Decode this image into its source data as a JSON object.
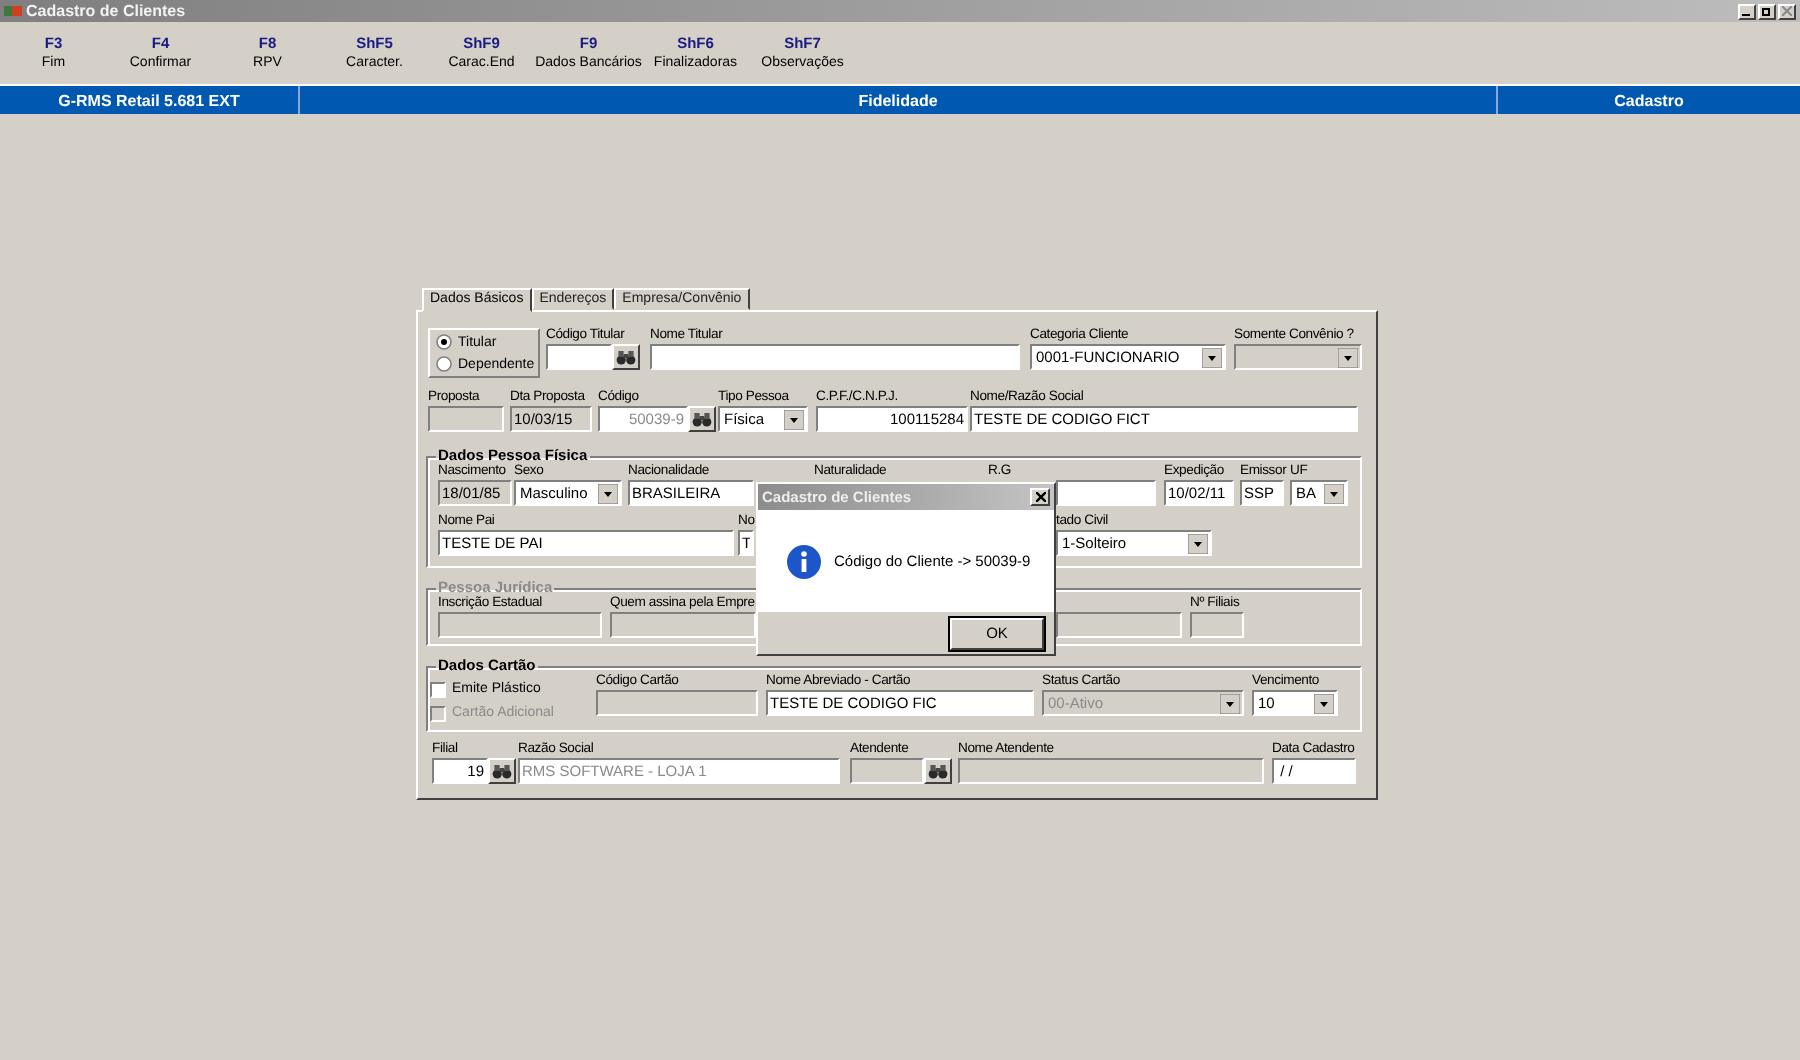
{
  "window": {
    "title": "Cadastro de Clientes"
  },
  "function_keys": [
    {
      "key": "F3",
      "label": "Fim"
    },
    {
      "key": "F4",
      "label": "Confirmar"
    },
    {
      "key": "F8",
      "label": "RPV"
    },
    {
      "key": "ShF5",
      "label": "Caracter."
    },
    {
      "key": "ShF9",
      "label": "Carac.End"
    },
    {
      "key": "F9",
      "label": "Dados Bancários"
    },
    {
      "key": "ShF6",
      "label": "Finalizadoras"
    },
    {
      "key": "ShF7",
      "label": "Observações"
    }
  ],
  "status_bar": [
    "G-RMS Retail 5.681 EXT",
    "Fidelidade",
    "Cadastro"
  ],
  "tabs": [
    {
      "label": "Dados Básicos",
      "selected": true
    },
    {
      "label": "Endereços",
      "selected": false
    },
    {
      "label": "Empresa/Convênio",
      "selected": false
    }
  ],
  "holder_type": [
    {
      "label": "Titular",
      "selected": true
    },
    {
      "label": "Dependente",
      "selected": false
    }
  ],
  "header_rows": [
    [
      {
        "label": "Código Titular",
        "kind": "text",
        "read_only": false,
        "lookup": true
      },
      {
        "label": "Nome Titular",
        "kind": "text",
        "read_only": false
      },
      {
        "label": "Categoria Cliente",
        "kind": "select",
        "read_only": false,
        "disabled": false,
        "value": "0001-FUNCIONARIO"
      },
      {
        "label": "Somente Convênio ?",
        "kind": "select",
        "read_only": true
      }
    ],
    [
      {
        "label": "Proposta",
        "kind": "text",
        "read_only": true
      },
      {
        "label": "Dta Proposta",
        "kind": "text",
        "read_only": true,
        "disabled": false,
        "value": "10/03/15"
      },
      {
        "label": "Código",
        "kind": "number",
        "read_only": false,
        "disabled": true,
        "value": "50039-9",
        "lookup": true
      },
      {
        "label": "Tipo Pessoa",
        "kind": "select",
        "read_only": false,
        "disabled": false,
        "value": "Física"
      },
      {
        "label": "C.P.F./C.N.P.J.",
        "kind": "number",
        "read_only": false,
        "disabled": false,
        "value": "100115284"
      },
      {
        "label": "Nome/Razão Social",
        "kind": "text",
        "read_only": false,
        "disabled": false,
        "value": "TESTE DE CODIGO FICT"
      }
    ]
  ],
  "groups": [
    {
      "title": "Dados Pessoa Física",
      "disabled": false,
      "rows": [
        [
          {
            "label": "Nascimento",
            "kind": "text",
            "read_only": true,
            "disabled": false,
            "value": "18/01/85"
          },
          {
            "label": "Sexo",
            "kind": "select",
            "read_only": false,
            "disabled": false,
            "value": "Masculino"
          },
          {
            "label": "Nacionalidade",
            "kind": "text",
            "read_only": false,
            "disabled": false,
            "value": "BRASILEIRA"
          },
          {
            "label": "Naturalidade",
            "kind": "label"
          },
          {
            "label": "R.G",
            "kind": "label"
          },
          {
            "kind": "text",
            "read_only": false
          },
          {
            "label": "Expedição",
            "kind": "text",
            "read_only": false,
            "disabled": false,
            "value": "10/02/11"
          },
          {
            "label": "Emissor",
            "kind": "text",
            "read_only": false,
            "disabled": false,
            "value": "SSP"
          },
          {
            "label": "UF",
            "kind": "select",
            "read_only": false,
            "disabled": false,
            "value": "BA"
          }
        ],
        [
          {
            "label": "Nome Pai",
            "kind": "text",
            "read_only": false,
            "disabled": false,
            "value": "TESTE DE PAI"
          },
          {
            "label": "No",
            "kind": "text",
            "read_only": false,
            "disabled": false,
            "value": "T"
          },
          {
            "label": "tado Civil",
            "kind": "select",
            "read_only": false,
            "disabled": false,
            "value": "1-Solteiro"
          }
        ]
      ]
    },
    {
      "title": "Pessoa Jurídica",
      "disabled": true,
      "rows": [
        [
          {
            "label": "Inscrição Estadual",
            "kind": "text",
            "read_only": true
          },
          {
            "label": "Quem assina pela Empre",
            "kind": "text",
            "read_only": true
          },
          {
            "kind": "text",
            "read_only": true
          },
          {
            "label": "Nº Filiais",
            "kind": "text",
            "read_only": true
          }
        ]
      ]
    },
    {
      "title": "Dados Cartão",
      "disabled": false,
      "checkboxes": [
        {
          "label": "Emite Plástico",
          "checked": false,
          "disabled": false
        },
        {
          "label": "Cartão Adicional",
          "checked": false,
          "disabled": true
        }
      ],
      "rows": [
        [
          {
            "label": "Código Cartão",
            "kind": "text",
            "read_only": true
          },
          {
            "label": "Nome Abreviado - Cartão",
            "kind": "text",
            "read_only": false,
            "disabled": false,
            "value": "TESTE DE CODIGO FIC"
          },
          {
            "label": "Status Cartão",
            "kind": "select",
            "read_only": true,
            "disabled": true,
            "value": "00-Ativo"
          },
          {
            "label": "Vencimento",
            "kind": "select",
            "read_only": false,
            "disabled": false,
            "value": "10"
          }
        ]
      ]
    }
  ],
  "footer_row": [
    {
      "label": "Filial",
      "kind": "number",
      "read_only": false,
      "disabled": false,
      "value": "19",
      "lookup": true
    },
    {
      "label": "Razão Social",
      "kind": "text",
      "read_only": false,
      "disabled": true,
      "value": "RMS SOFTWARE - LOJA 1"
    },
    {
      "label": "Atendente",
      "kind": "text",
      "read_only": true,
      "lookup": true
    },
    {
      "label": "Nome Atendente",
      "kind": "text",
      "read_only": true
    },
    {
      "label": "Data Cadastro",
      "kind": "text",
      "read_only": false,
      "disabled": false,
      "value": " / /"
    }
  ],
  "dialog": {
    "title": "Cadastro de Clientes",
    "message": "Código do Cliente -> 50039-9",
    "buttons": [
      "OK"
    ]
  }
}
